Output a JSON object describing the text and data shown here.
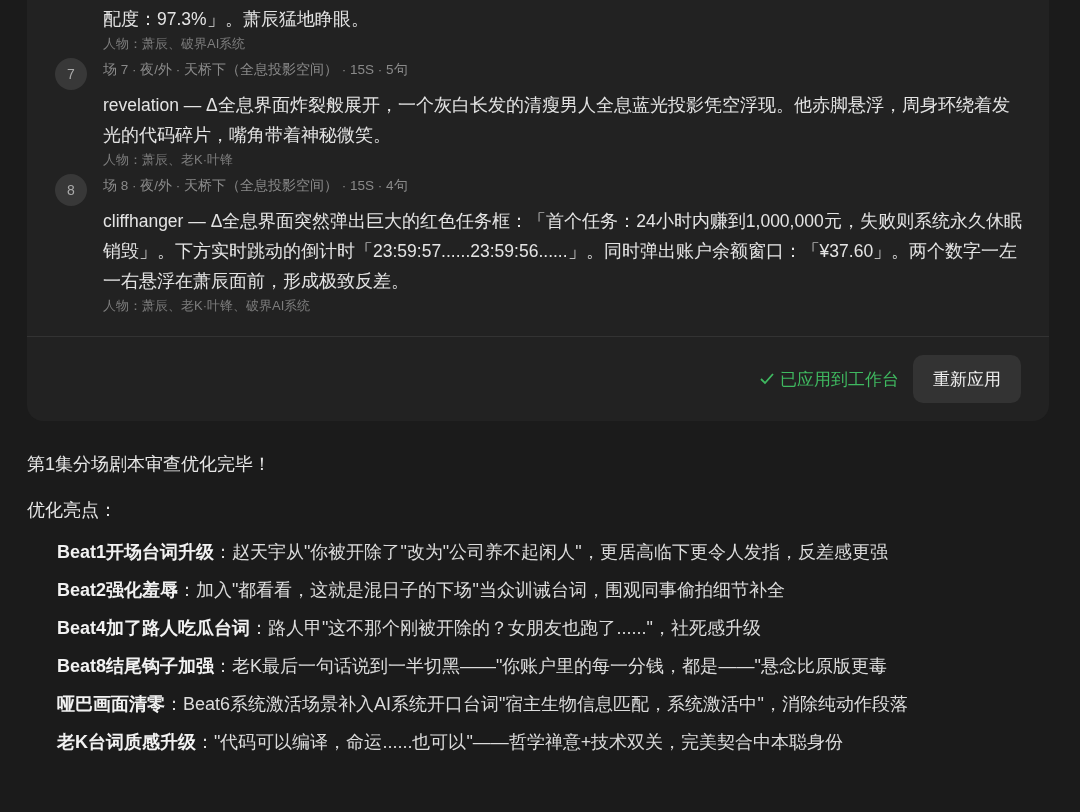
{
  "scene_card": {
    "scenes": [
      {
        "description": "配度：97.3%」。萧辰猛地睁眼。",
        "characters": "人物：萧辰、破界AI系统"
      },
      {
        "number": "7",
        "heading": "场 7 · 夜/外 · 天桥下（全息投影空间） · 15S · 5句",
        "description": "revelation — Δ全息界面炸裂般展开，一个灰白长发的清瘦男人全息蓝光投影凭空浮现。他赤脚悬浮，周身环绕着发光的代码碎片，嘴角带着神秘微笑。",
        "characters": "人物：萧辰、老K·叶锋"
      },
      {
        "number": "8",
        "heading": "场 8 · 夜/外 · 天桥下（全息投影空间） · 15S · 4句",
        "description": "cliffhanger — Δ全息界面突然弹出巨大的红色任务框：「首个任务：24小时内赚到1,000,000元，失败则系统永久休眠销毁」。下方实时跳动的倒计时「23:59:57......23:59:56......」。同时弹出账户余额窗口：「¥37.60」。两个数字一左一右悬浮在萧辰面前，形成极致反差。",
        "characters": "人物：萧辰、老K·叶锋、破界AI系统"
      }
    ],
    "status": {
      "text": "已应用到工作台",
      "applied": true
    },
    "button": "重新应用"
  },
  "summary": {
    "title": "第1集分场剧本审查优化完毕！",
    "subtitle": "优化亮点：",
    "highlights": [
      "**Beat1开场台词升级**：赵天宇从\"你被开除了\"改为\"公司养不起闲人\"，更居高临下更令人发指，反差感更强",
      "**Beat2强化羞辱**：加入\"都看看，这就是混日子的下场\"当众训诫台词，围观同事偷拍细节补全",
      "**Beat4加了路人吃瓜台词**：路人甲\"这不那个刚被开除的？女朋友也跑了......\"，社死感升级",
      "**Beat8结尾钩子加强**：老K最后一句话说到一半切黑——\"你账户里的每一分钱，都是——\"悬念比原版更毒",
      "**哑巴画面清零**：Beat6系统激活场景补入AI系统开口台词\"宿主生物信息匹配，系统激活中\"，消除纯动作段落",
      "**老K台词质感升级**：\"代码可以编译，命运......也可以\"——哲学禅意+技术双关，完美契合中本聪身份"
    ]
  }
}
